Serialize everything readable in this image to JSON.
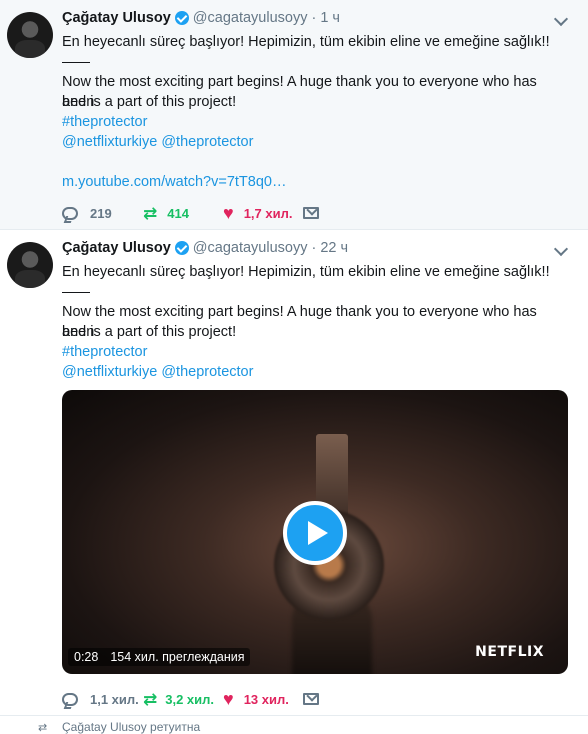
{
  "tweets": [
    {
      "name": "Çağatay Ulusoy",
      "handle": "@cagatayulusoyy",
      "time": "1 ч",
      "line1": "En heyecanlı süreç başlıyor! Hepimizin, tüm ekibin eline ve emeğine sağlık!!",
      "line2a": "Now the most exciting part begins! A huge thank you to everyone who has been",
      "line2b": "and is a part of this project!",
      "hashtag": "#theprotector",
      "mentions": "@netflixturkiye @theprotector",
      "url": "m.youtube.com/watch?v=7tT8q0…",
      "replies": "219",
      "retweets": "414",
      "likes": "1,7 хил."
    },
    {
      "name": "Çağatay Ulusoy",
      "handle": "@cagatayulusoyy",
      "time": "22 ч",
      "line1": "En heyecanlı süreç başlıyor! Hepimizin, tüm ekibin eline ve emeğine sağlık!!",
      "line2a": "Now the most exciting part begins! A huge thank you to everyone who has been",
      "line2b": "and is a part of this project!",
      "hashtag": "#theprotector",
      "mentions": "@netflixturkiye @theprotector",
      "video": {
        "duration": "0:28",
        "views": "154 хил. преглеждания",
        "brand": "NETFLIX"
      },
      "replies": "1,1 хил.",
      "retweets": "3,2 хил.",
      "likes": "13 хил."
    }
  ],
  "footer": {
    "retweeted_label": "Çağatay Ulusoy ретуитна"
  },
  "icons": {
    "reply": "reply-icon",
    "retweet": "retweet-icon",
    "like": "heart-icon",
    "dm": "mail-icon",
    "verified": "verified-icon",
    "more": "chevron-down-icon"
  },
  "colors": {
    "link": "#1b95e0",
    "retweet": "#17bf63",
    "like": "#e0245e",
    "muted": "#657786",
    "verified": "#1da1f2"
  }
}
